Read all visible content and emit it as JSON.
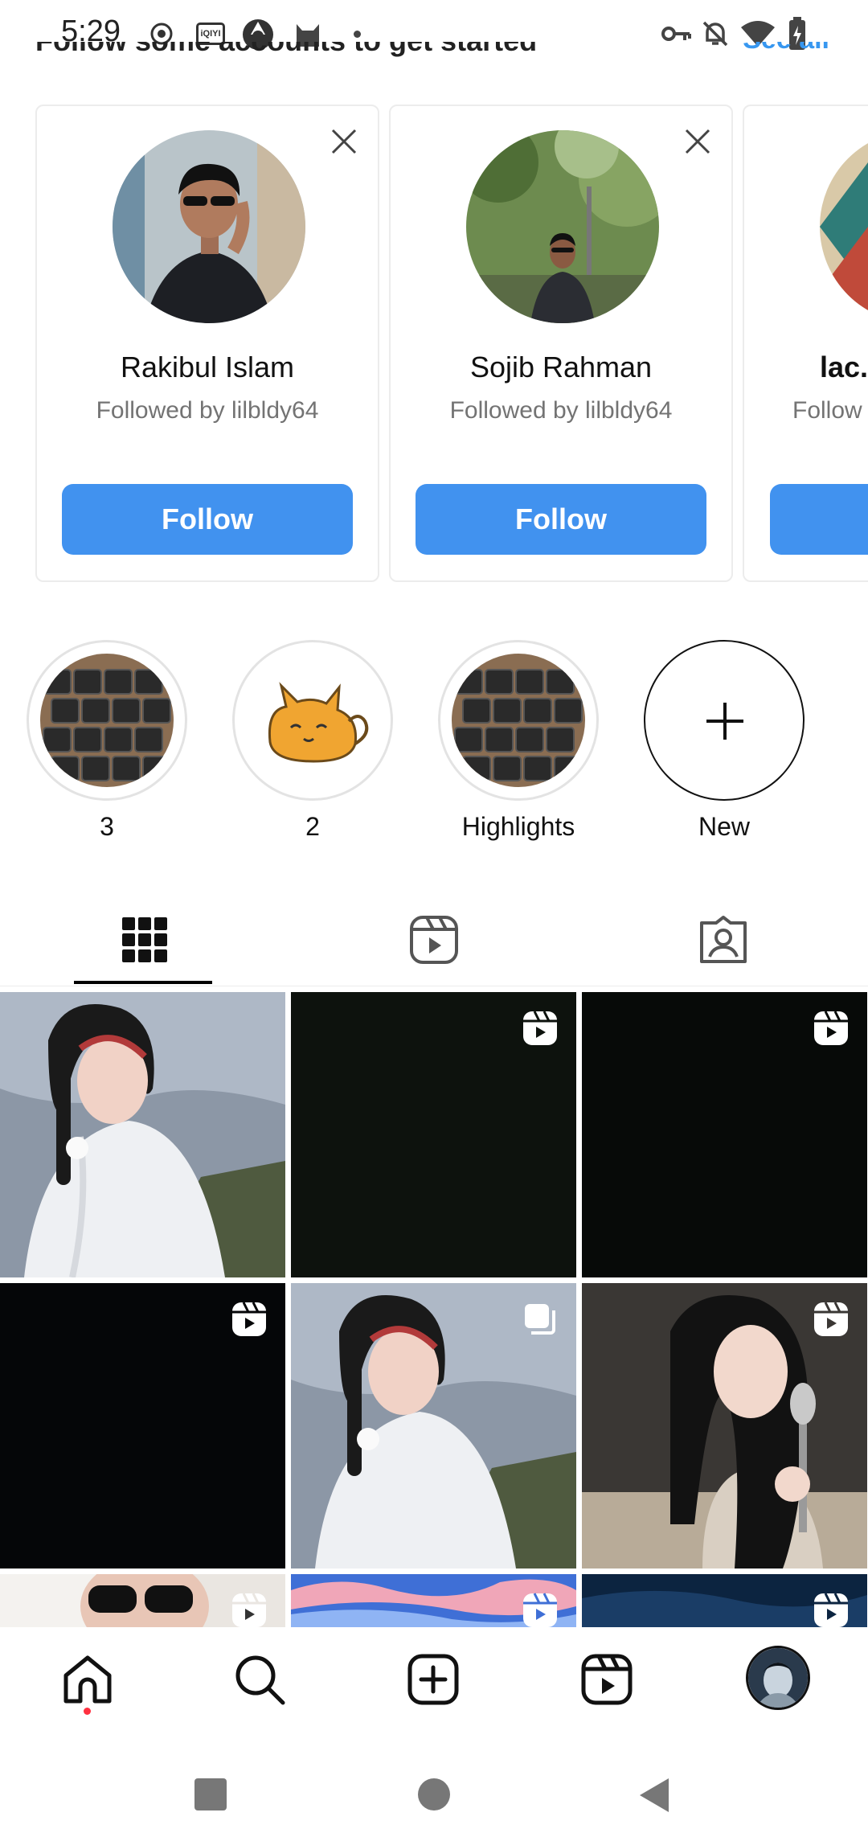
{
  "status_bar": {
    "time": "5:29",
    "left_icons": [
      "record-icon",
      "iqiyi-icon",
      "browser-icon",
      "cat-icon",
      "dot-icon"
    ],
    "right_icons": [
      "key-icon",
      "bell-off-icon",
      "wifi-icon",
      "battery-charging-icon"
    ],
    "iqiyi_text": "iQIYI"
  },
  "suggestions": {
    "header": "Follow some accounts to get started",
    "see_all": "See all",
    "cards": [
      {
        "name": "Rakibul Islam",
        "subtitle": "Followed by lilbldy64",
        "button": "Follow"
      },
      {
        "name": "Sojib Rahman",
        "subtitle": "Followed by lilbldy64",
        "button": "Follow"
      },
      {
        "name": "lac.",
        "subtitle": "Follow",
        "button": ""
      }
    ]
  },
  "highlights": [
    {
      "label": "3",
      "image": "keyboard"
    },
    {
      "label": "2",
      "image": "cat"
    },
    {
      "label": "Highlights",
      "image": "keyboard"
    },
    {
      "label": "New",
      "image": "plus"
    }
  ],
  "tabs": [
    "grid-icon",
    "reels-icon",
    "tagged-icon"
  ],
  "active_tab": "grid",
  "grid": [
    {
      "kind": "photo",
      "badge": "none"
    },
    {
      "kind": "dark",
      "badge": "reel-icon"
    },
    {
      "kind": "dark",
      "badge": "reel-icon"
    },
    {
      "kind": "dark",
      "badge": "reel-icon"
    },
    {
      "kind": "photo",
      "badge": "carousel-icon"
    },
    {
      "kind": "photo",
      "badge": "reel-icon"
    },
    {
      "kind": "photo",
      "badge": "reel-icon"
    },
    {
      "kind": "photo",
      "badge": "reel-icon"
    },
    {
      "kind": "photo",
      "badge": "reel-icon"
    }
  ],
  "bottom_nav": [
    "home-icon",
    "search-icon",
    "create-icon",
    "reels-icon",
    "profile-avatar"
  ],
  "system_nav": [
    "recents-button",
    "home-button",
    "back-button"
  ],
  "colors": {
    "accent": "#4192ef",
    "notification_dot": "#ff3040",
    "muted_text": "#737373"
  }
}
